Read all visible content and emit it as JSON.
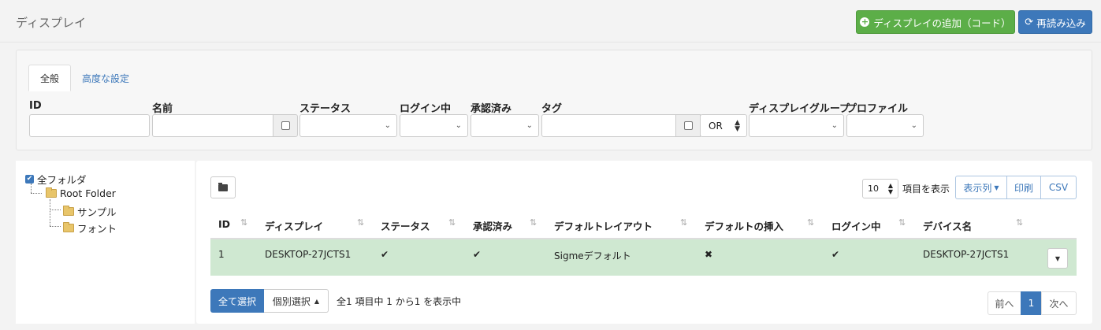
{
  "header": {
    "title": "ディスプレイ",
    "add_button": "ディスプレイの追加（コード）",
    "reload_button": "再読み込み"
  },
  "filter": {
    "tabs": [
      {
        "label": "全般"
      },
      {
        "label": "高度な設定"
      }
    ],
    "labels": {
      "id": "ID",
      "name": "名前",
      "status": "ステータス",
      "logged_in": "ログイン中",
      "authorized": "承認済み",
      "tags": "タグ",
      "display_group": "ディスプレイグループ",
      "profile": "プロファイル"
    },
    "tag_operator": "OR"
  },
  "tree": {
    "all_folders": "全フォルダ",
    "root": "Root Folder",
    "children": [
      "サンプル",
      "フォント"
    ]
  },
  "table": {
    "page_size": "10",
    "page_size_label": "項目を表示",
    "columns_button": "表示列",
    "print_button": "印刷",
    "csv_button": "CSV",
    "headers": [
      "ID",
      "ディスプレイ",
      "ステータス",
      "承認済み",
      "デフォルトレイアウト",
      "デフォルトの挿入",
      "ログイン中",
      "デバイス名"
    ],
    "rows": [
      {
        "id": "1",
        "display": "DESKTOP-27JCTS1",
        "status": "✔",
        "authorized": "✔",
        "default_layout": "Sigmeデフォルト",
        "default_insert": "✖",
        "logged_in": "✔",
        "device_name": "DESKTOP-27JCTS1"
      }
    ],
    "select_all": "全て選択",
    "individual_select": "個別選択",
    "info": "全1 項目中 1 から1 を表示中",
    "prev": "前へ",
    "page": "1",
    "next": "次へ"
  },
  "colors": {
    "green": "#5cae48",
    "blue": "#3d78ba",
    "row_highlight": "#cfe8d1"
  }
}
